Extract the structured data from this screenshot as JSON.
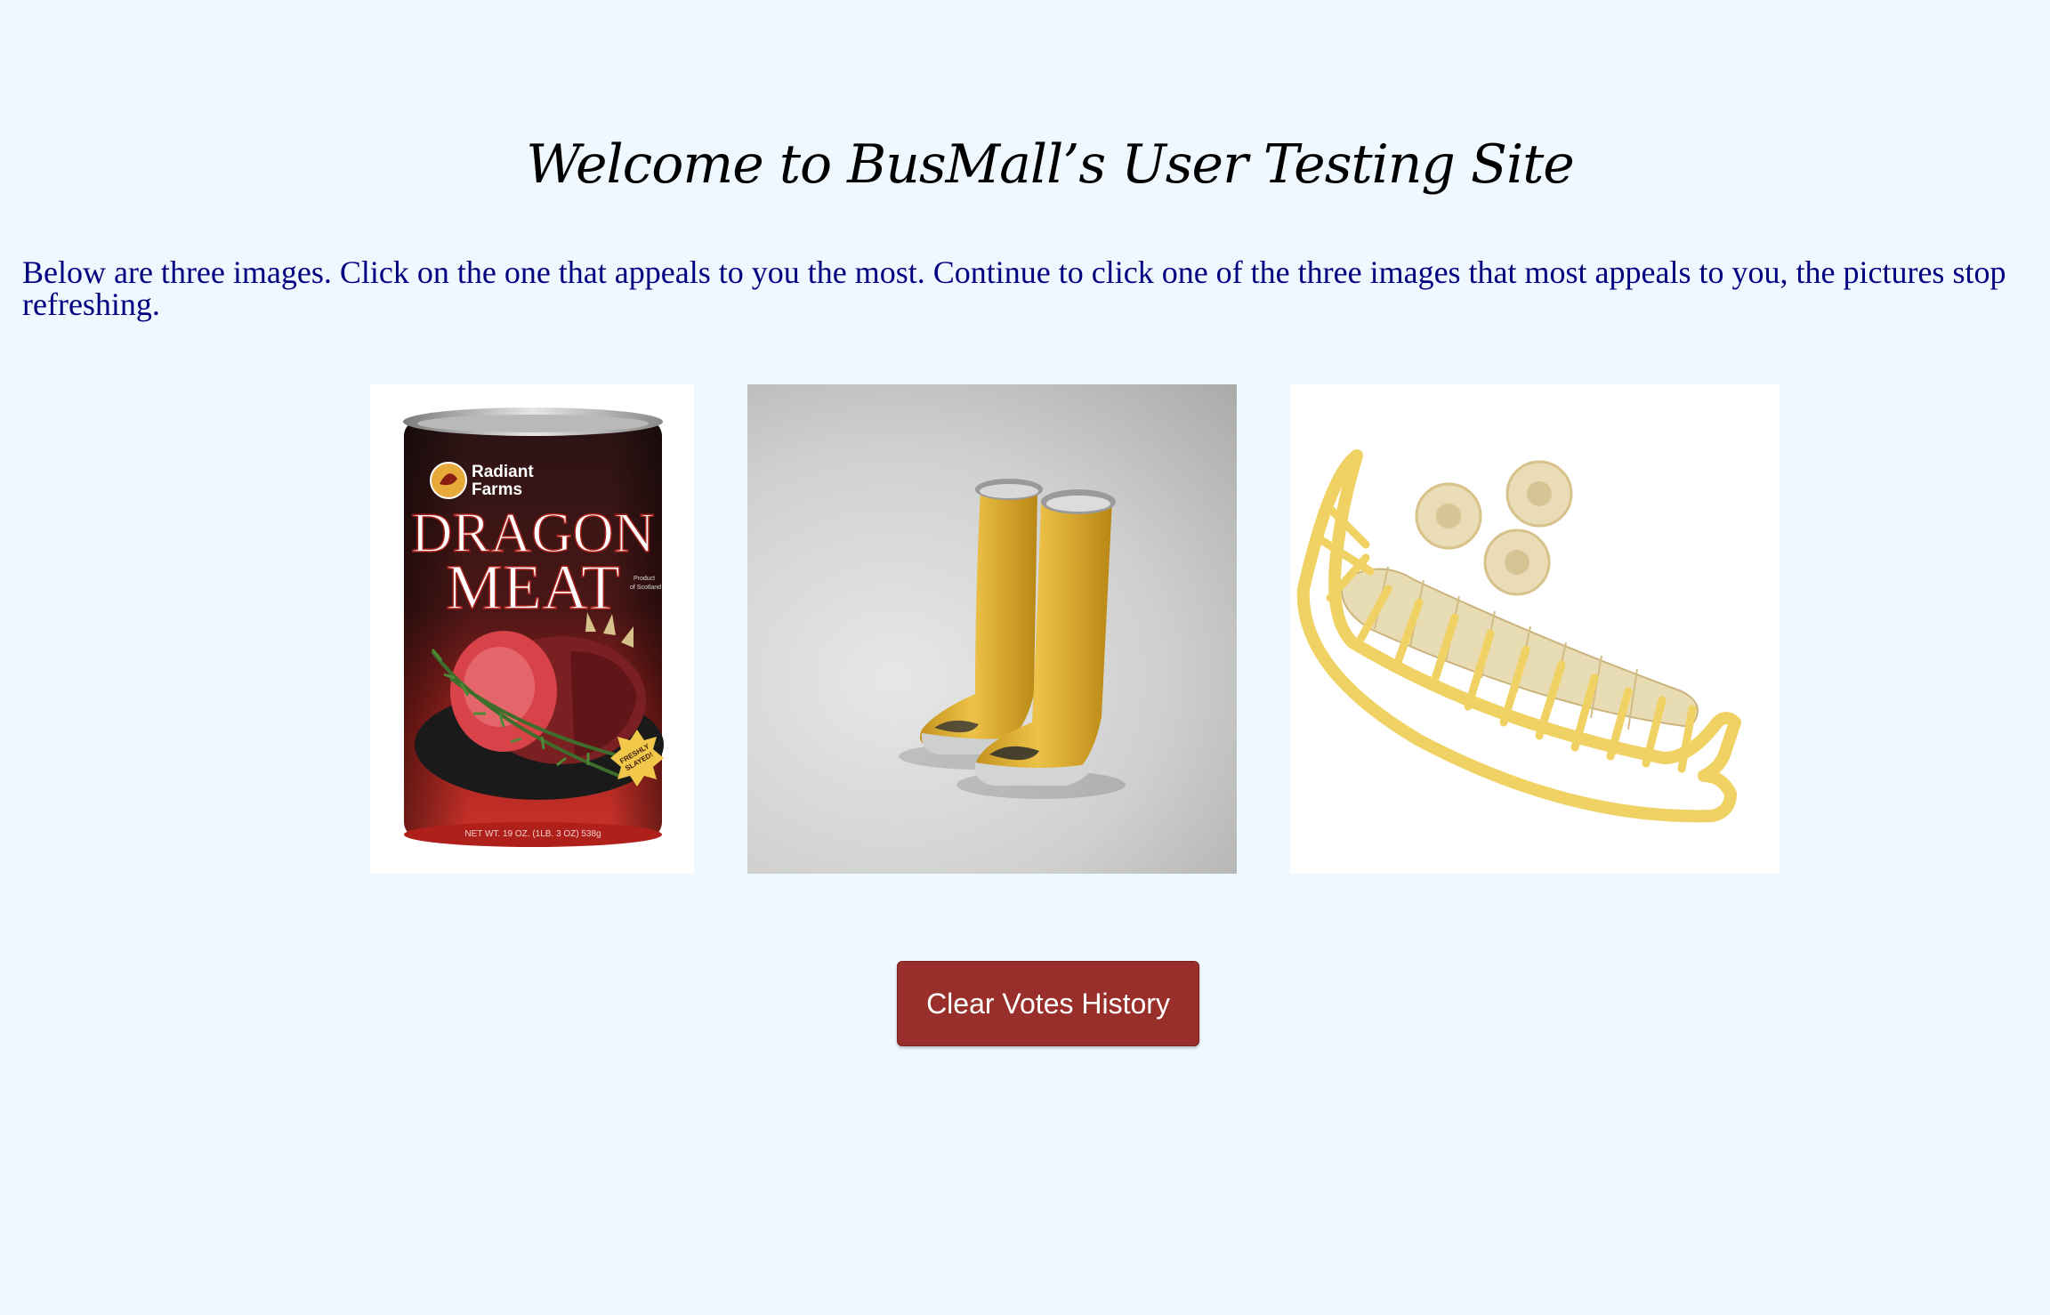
{
  "page": {
    "title": "Welcome to BusMall’s User Testing Site",
    "instructions": "Below are three images. Click on the one that appeals to you the most. Continue to click one of the three images that most appeals to you, the pictures stop refreshing."
  },
  "products": [
    {
      "name": "dragon-meat-can",
      "brand": "Radiant",
      "brand_line2": "Farms",
      "label_line1": "DRAGON",
      "label_line2": "MEAT",
      "badge_line1": "FRESHLY",
      "badge_line2": "SLAYED!",
      "side_text_1": "Product",
      "side_text_2": "of Scotland",
      "net_weight": "NET WT. 19 OZ. (1LB. 3 OZ) 538g"
    },
    {
      "name": "open-toe-rain-boots"
    },
    {
      "name": "banana-slicer"
    }
  ],
  "actions": {
    "clear_votes": "Clear Votes History"
  },
  "colors": {
    "background": "#f0f8ff",
    "intro_text": "#000080",
    "button": "#992f2b",
    "boot_yellow": "#e8b935",
    "slicer_yellow": "#f2d66b"
  }
}
